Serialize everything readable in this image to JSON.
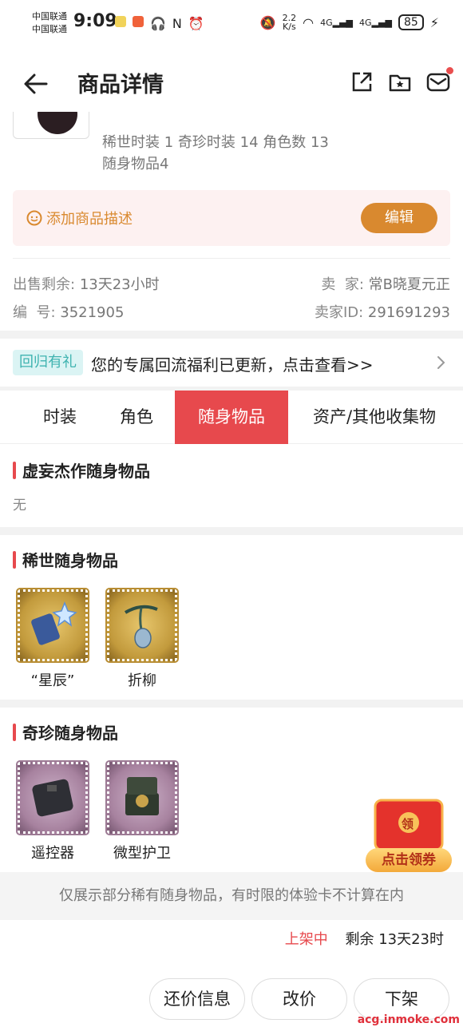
{
  "status_bar": {
    "carrier1": "中国联通",
    "carrier2": "中国联通",
    "time": "9:09",
    "net_speed_value": "2.2",
    "net_speed_unit": "K/s",
    "network1": "4G",
    "network2": "4G",
    "battery": "85"
  },
  "nav": {
    "title": "商品详情"
  },
  "summary": {
    "line1": "稀世时装 1 奇珍时装 14 角色数 13",
    "line2": "随身物品4"
  },
  "desc": {
    "add_label": "添加商品描述",
    "edit_label": "编辑"
  },
  "info": {
    "remaining_label": "出售剩余:",
    "remaining_value": "13天23小时",
    "seller_label": "卖  家:",
    "seller_value": "常B晓夏元正",
    "id_label": "编  号:",
    "id_value": "3521905",
    "seller_id_label": "卖家ID:",
    "seller_id_value": "291691293"
  },
  "promo": {
    "tag": "回归有礼",
    "text": "您的专属回流福利已更新，点击查看>>"
  },
  "tabs": [
    {
      "label": "时装"
    },
    {
      "label": "角色"
    },
    {
      "label": "随身物品"
    },
    {
      "label": "资产/其他收集物"
    }
  ],
  "sections": {
    "masterpiece_title": "虚妄杰作随身物品",
    "masterpiece_empty": "无",
    "rare_title": "稀世随身物品",
    "rare_items": [
      {
        "name": "“星辰”"
      },
      {
        "name": "折柳"
      }
    ],
    "exotic_title": "奇珍随身物品",
    "exotic_items": [
      {
        "name": "遥控器"
      },
      {
        "name": "微型护卫"
      }
    ]
  },
  "notice": "仅展示部分稀有随身物品，有时限的体验卡不计算在内",
  "status": {
    "state": "上架中",
    "remaining": "剩余 13天23时"
  },
  "actions": {
    "bargain": "还价信息",
    "change_price": "改价",
    "take_down": "下架"
  },
  "coupon": {
    "badge": "领",
    "label": "点击领券"
  },
  "watermark": "acg.inmoke.com",
  "colors": {
    "accent_red": "#e7494d",
    "accent_orange": "#d9892f",
    "promo_teal": "#3fb3b0"
  }
}
